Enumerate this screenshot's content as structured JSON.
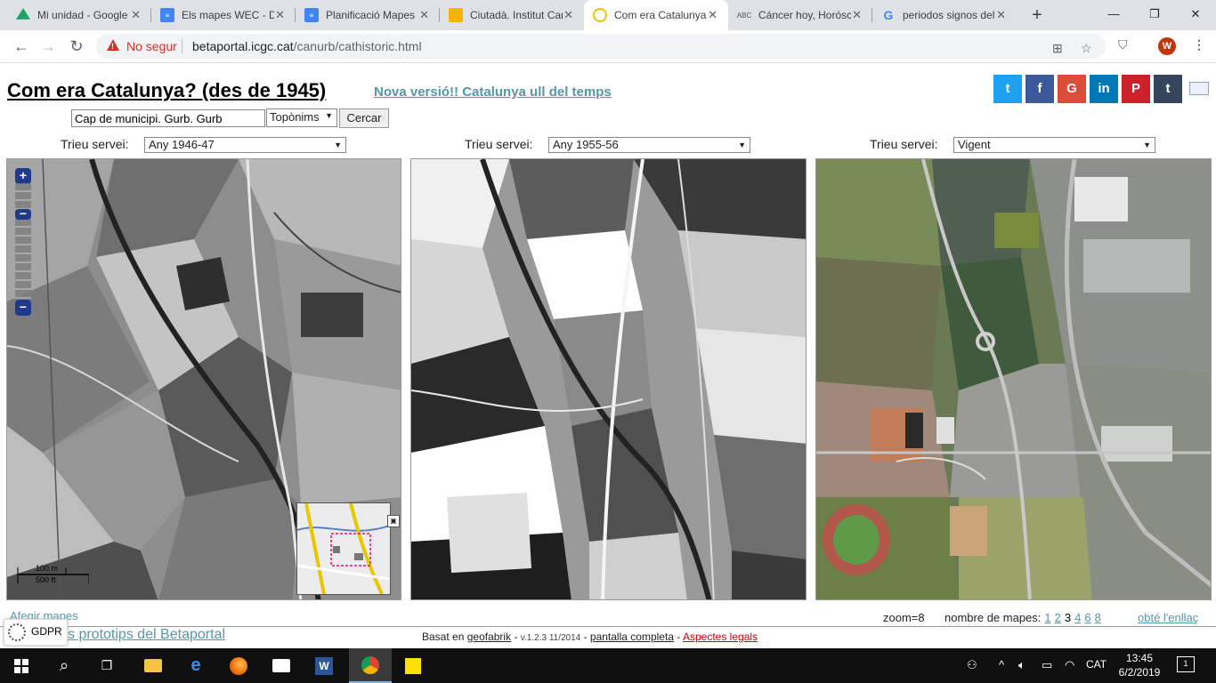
{
  "tabs": [
    {
      "label": "Mi unidad - Google Drive",
      "favicon": "drive-icon",
      "color": "#1fa463"
    },
    {
      "label": "Els mapes WEC - Documentos",
      "favicon": "docs-icon",
      "color": "#4285f4"
    },
    {
      "label": "Planificació Mapes",
      "favicon": "docs-icon",
      "color": "#4285f4"
    },
    {
      "label": "Ciutadà. Institut Cartogràfic",
      "favicon": "slides-icon",
      "color": "#f4b400"
    },
    {
      "label": "Com era Catalunya?",
      "favicon": "loading-icon",
      "color": "#f2c200"
    },
    {
      "label": "Cáncer hoy, Horóscopo",
      "favicon": "abc-icon",
      "color": "#555555"
    },
    {
      "label": "periodos signos del zodiaco",
      "favicon": "google-icon",
      "color": "#4285f4"
    }
  ],
  "browser": {
    "security_label": "No segur",
    "url_host": "betaportal.icgc.cat",
    "url_path": "/canurb/cathistoric.html",
    "avatar_letter": "W"
  },
  "page": {
    "title": "Com era Catalunya? (des de 1945)",
    "new_version_link": "Nova versió!! Catalunya ull del temps",
    "search_value": "Cap de municipi. Gurb. Gurb",
    "search_type": "Topònims",
    "search_button": "Cercar",
    "service_label": "Trieu servei:",
    "panels": [
      {
        "service": "Any 1946-47"
      },
      {
        "service": "Any 1955-56"
      },
      {
        "service": "Vigent"
      }
    ],
    "zoom_in": "+",
    "zoom_out": "−",
    "scale_m": "100 m",
    "scale_ft": "500 ft",
    "zoom_text": "zoom=8",
    "num_maps_label": "nombre de mapes:",
    "num_maps_options": [
      "1",
      "2",
      "3",
      "4",
      "6",
      "8"
    ],
    "current_num_maps": "3",
    "get_link": "obté l'enllaç",
    "obscured_link": "Afegir mapes",
    "gdpr_label": "GDPR",
    "prototips_link": "s prototips del Betaportal",
    "footer": {
      "based_on": "Basat en",
      "geofabrik": "geofabrik",
      "version": "v.1.2.3 11/2014",
      "fullscreen": "pantalla completa",
      "legal": "Aspectes legals"
    },
    "social": [
      {
        "name": "twitter",
        "glyph": "t",
        "color": "#1da1f2"
      },
      {
        "name": "facebook",
        "glyph": "f",
        "color": "#3b5998"
      },
      {
        "name": "google-plus",
        "glyph": "G",
        "color": "#dd4b39"
      },
      {
        "name": "linkedin",
        "glyph": "in",
        "color": "#0077b5"
      },
      {
        "name": "pinterest",
        "glyph": "P",
        "color": "#cb2027"
      },
      {
        "name": "tumblr",
        "glyph": "t",
        "color": "#35465c"
      }
    ]
  },
  "taskbar": {
    "language": "CAT",
    "time": "13:45",
    "date": "6/2/2019",
    "notifications": "1"
  }
}
